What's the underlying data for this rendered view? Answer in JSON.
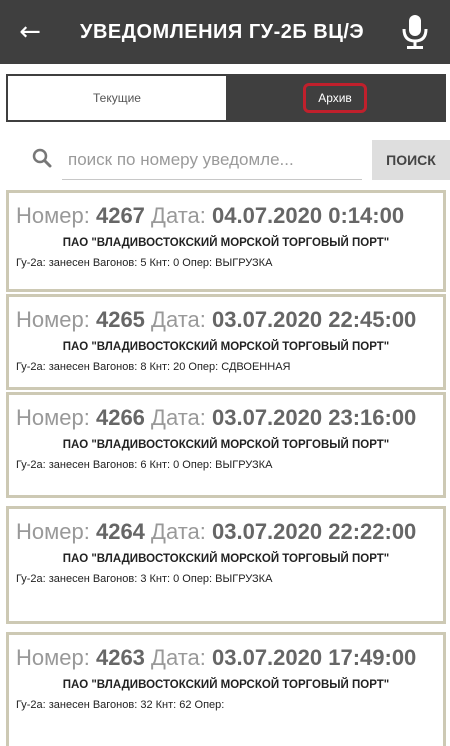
{
  "header": {
    "back_icon": "arrow-left-icon",
    "title": "УВЕДОМЛЕНИЯ ГУ-2Б ВЦ/Э",
    "mic_icon": "microphone-icon"
  },
  "tabs": [
    {
      "label": "Текущие",
      "active": false
    },
    {
      "label": "Архив",
      "active": true
    }
  ],
  "search": {
    "placeholder": "поиск по номеру уведомле...",
    "value": "",
    "button_label": "ПОИСК"
  },
  "notifications": [
    {
      "number_label": "Номер:",
      "number": "4267",
      "date_label": "Дата:",
      "date": "04.07.2020 0:14:00",
      "org": "ПАО \"ВЛАДИВОСТОКСКИЙ МОРСКОЙ ТОРГОВЫЙ ПОРТ\"",
      "details": "Гу-2а: занесен Вагонов: 5 Кнт: 0 Опер: ВЫГРУЗКА"
    },
    {
      "number_label": "Номер:",
      "number": "4265",
      "date_label": "Дата:",
      "date": "03.07.2020 22:45:00",
      "org": "ПАО \"ВЛАДИВОСТОКСКИЙ МОРСКОЙ ТОРГОВЫЙ ПОРТ\"",
      "details": "Гу-2а: занесен Вагонов: 8 Кнт: 20 Опер: СДВОЕННАЯ"
    },
    {
      "number_label": "Номер:",
      "number": "4266",
      "date_label": "Дата:",
      "date": "03.07.2020 23:16:00",
      "org": "ПАО \"ВЛАДИВОСТОКСКИЙ МОРСКОЙ ТОРГОВЫЙ ПОРТ\"",
      "details": "Гу-2а: занесен Вагонов: 6 Кнт: 0 Опер: ВЫГРУЗКА"
    },
    {
      "number_label": "Номер:",
      "number": "4264",
      "date_label": "Дата:",
      "date": "03.07.2020 22:22:00",
      "org": "ПАО \"ВЛАДИВОСТОКСКИЙ МОРСКОЙ ТОРГОВЫЙ ПОРТ\"",
      "details": "Гу-2а: занесен Вагонов: 3 Кнт: 0 Опер: ВЫГРУЗКА"
    },
    {
      "number_label": "Номер:",
      "number": "4263",
      "date_label": "Дата:",
      "date": "03.07.2020 17:49:00",
      "org": "ПАО \"ВЛАДИВОСТОКСКИЙ МОРСКОЙ ТОРГОВЫЙ ПОРТ\"",
      "details": "Гу-2а: занесен Вагонов: 32 Кнт: 62 Опер:"
    }
  ],
  "colors": {
    "appbar": "#3f3f3f",
    "card_border": "#cdc9b4",
    "archive_highlight": "#c0202c"
  }
}
